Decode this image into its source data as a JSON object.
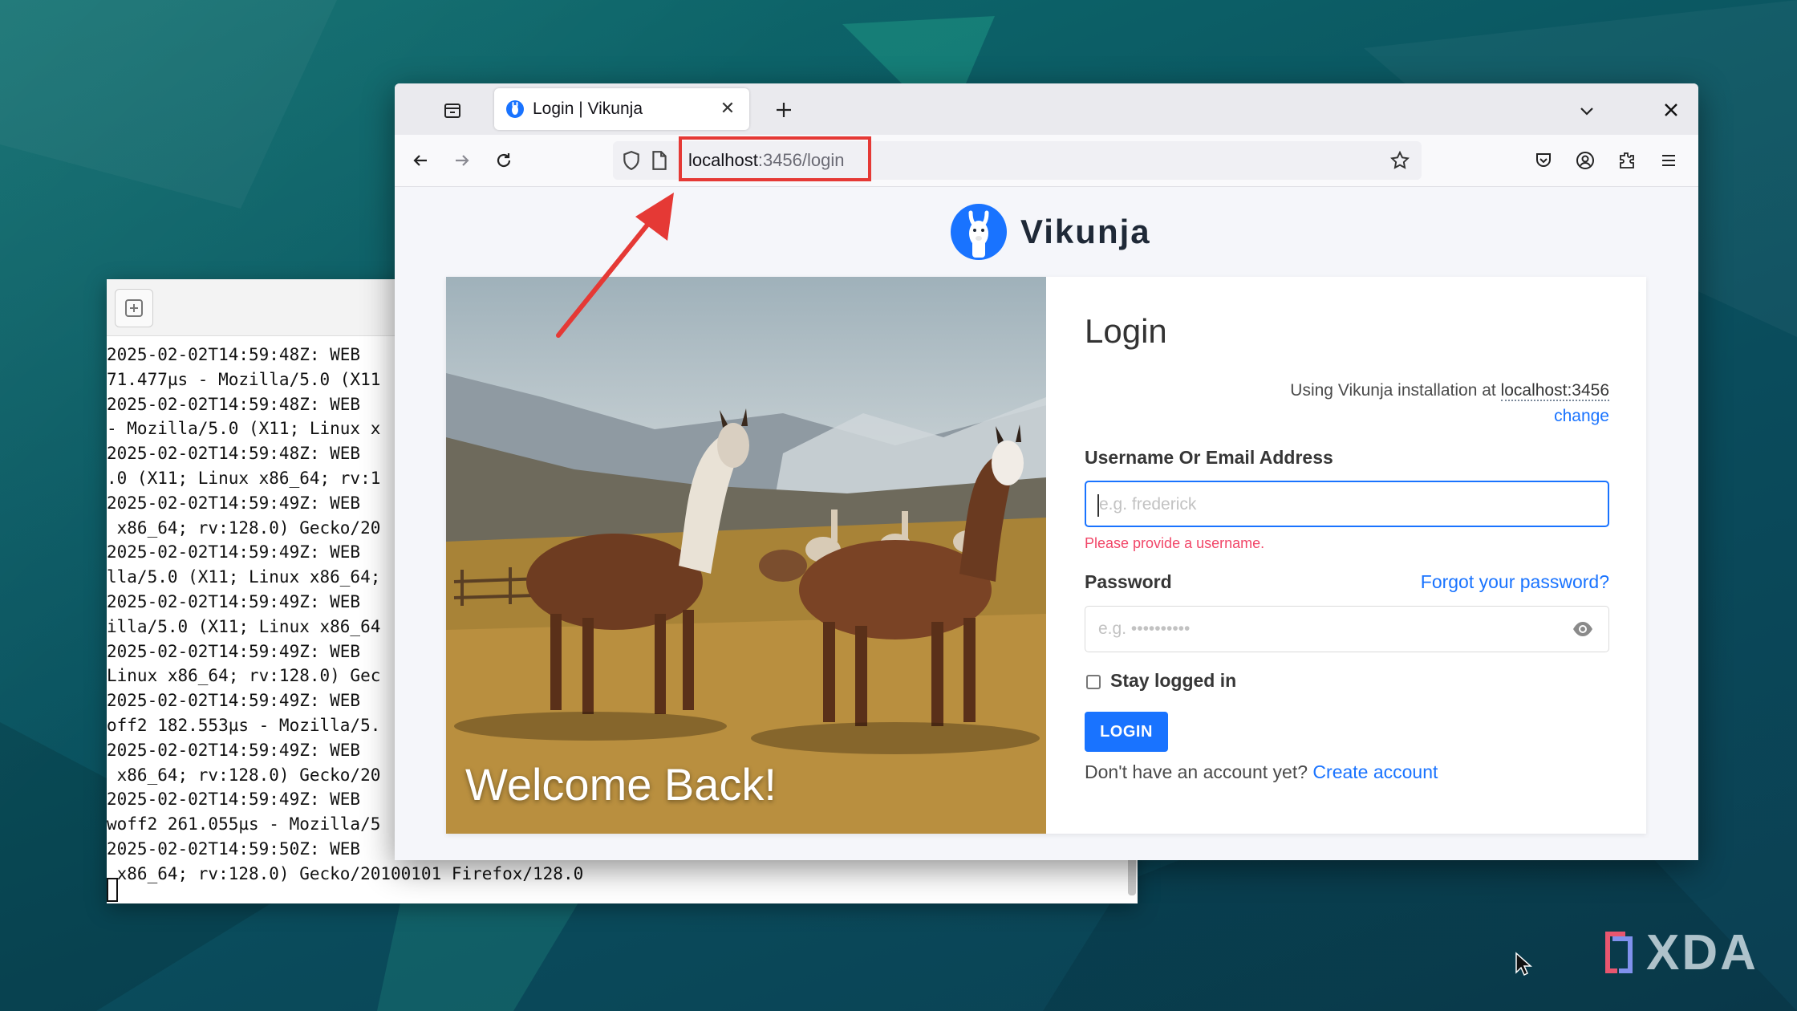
{
  "terminal": {
    "lines": [
      "2025-02-02T14:59:48Z: WEB",
      "71.477µs - Mozilla/5.0 (X11",
      "2025-02-02T14:59:48Z: WEB",
      "- Mozilla/5.0 (X11; Linux x",
      "2025-02-02T14:59:48Z: WEB",
      ".0 (X11; Linux x86_64; rv:1",
      "2025-02-02T14:59:49Z: WEB",
      " x86_64; rv:128.0) Gecko/20",
      "2025-02-02T14:59:49Z: WEB",
      "lla/5.0 (X11; Linux x86_64;",
      "2025-02-02T14:59:49Z: WEB",
      "illa/5.0 (X11; Linux x86_64",
      "2025-02-02T14:59:49Z: WEB",
      "Linux x86_64; rv:128.0) Gec",
      "2025-02-02T14:59:49Z: WEB",
      "off2 182.553µs - Mozilla/5.",
      "2025-02-02T14:59:49Z: WEB",
      " x86_64; rv:128.0) Gecko/20",
      "2025-02-02T14:59:49Z: WEB",
      "woff2 261.055µs - Mozilla/5",
      "2025-02-02T14:59:50Z: WEB",
      " x86_64; rv:128.0) Gecko/20100101 Firefox/128.0"
    ]
  },
  "browser": {
    "tab_title": "Login | Vikunja",
    "url_host": "localhost",
    "url_rest": ":3456/login"
  },
  "page": {
    "brand_name": "Vikunja",
    "hero_title": "Welcome Back!",
    "form": {
      "title": "Login",
      "install_prefix": "Using Vikunja installation at ",
      "install_host": "localhost:3456",
      "change_label": "change",
      "username_label": "Username Or Email Address",
      "username_placeholder": "e.g. frederick",
      "username_error": "Please provide a username.",
      "password_label": "Password",
      "forgot_label": "Forgot your password?",
      "password_placeholder": "e.g. ••••••••••",
      "stay_logged_in": "Stay logged in",
      "login_button": "LOGIN",
      "signup_prompt": "Don't have an account yet? ",
      "signup_link": "Create account"
    }
  },
  "watermark": "XDA",
  "colors": {
    "accent": "#1973ff",
    "danger": "#f14668",
    "annotation": "#e53935"
  }
}
